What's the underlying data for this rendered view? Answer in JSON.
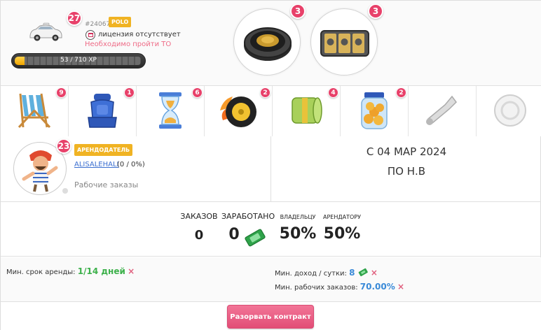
{
  "car": {
    "icon": "taxi-car-icon",
    "level": "27",
    "id": "#240675",
    "tag": "POLO",
    "license_icon": "license-icon",
    "license_text": "лицензия отсутствует",
    "license_warning": "Необходимо пройти ТО",
    "xp_text": "53 / 710 XP",
    "xp_progress": 0.075
  },
  "slots": [
    {
      "icon": "subwoofer-icon",
      "count": "3"
    },
    {
      "icon": "slot-machine-icon",
      "count": "3"
    }
  ],
  "items": [
    {
      "icon": "beach-chair-icon",
      "count": "9"
    },
    {
      "icon": "car-seat-icon",
      "count": "1"
    },
    {
      "icon": "hourglass-icon",
      "count": "6"
    },
    {
      "icon": "flaming-wheel-icon",
      "count": "2"
    },
    {
      "icon": "money-roll-icon",
      "count": "4"
    },
    {
      "icon": "coin-jar-icon",
      "count": "2"
    },
    {
      "icon": "horn-icon",
      "count": ""
    },
    {
      "icon": "empty-slot-icon",
      "count": ""
    }
  ],
  "owner": {
    "avatar": "pirate-avatar-icon",
    "level": "23",
    "role": "АРЕНДОДАТЕЛЬ",
    "name": "ALISALEHALI",
    "share": "(0 / 0%)",
    "orders_label": "Рабочие заказы"
  },
  "period": {
    "from": "С 04 МАР 2024",
    "to": "ПО Н.В"
  },
  "stats": {
    "orders_label": "ЗАКАЗОВ",
    "orders_value": "0",
    "earned_label": "ЗАРАБОТАНО",
    "earned_value": "0",
    "earned_icon": "money-ticket-icon",
    "owner_label": "ВЛАДЕЛЬЦУ",
    "owner_value": "50%",
    "renter_label": "АРЕНДАТОРУ",
    "renter_value": "50%"
  },
  "conditions": {
    "min_term_label": "Мин. срок аренды:",
    "min_term_value": "1/14 дней",
    "min_income_label": "Мин. доход / сутки:",
    "min_income_value": "8",
    "min_orders_label": "Мин. рабочих заказов:",
    "min_orders_value": "70.00%",
    "remove_symbol": "×"
  },
  "actions": {
    "break_contract": "Разорвать контракт"
  },
  "colors": {
    "badge": "#e8416a",
    "tag": "#f0b323",
    "warning": "#ee6b86",
    "link": "#3a6ed0",
    "green": "#3db14b",
    "blue": "#3a8ad8",
    "button": "#e24d76"
  }
}
